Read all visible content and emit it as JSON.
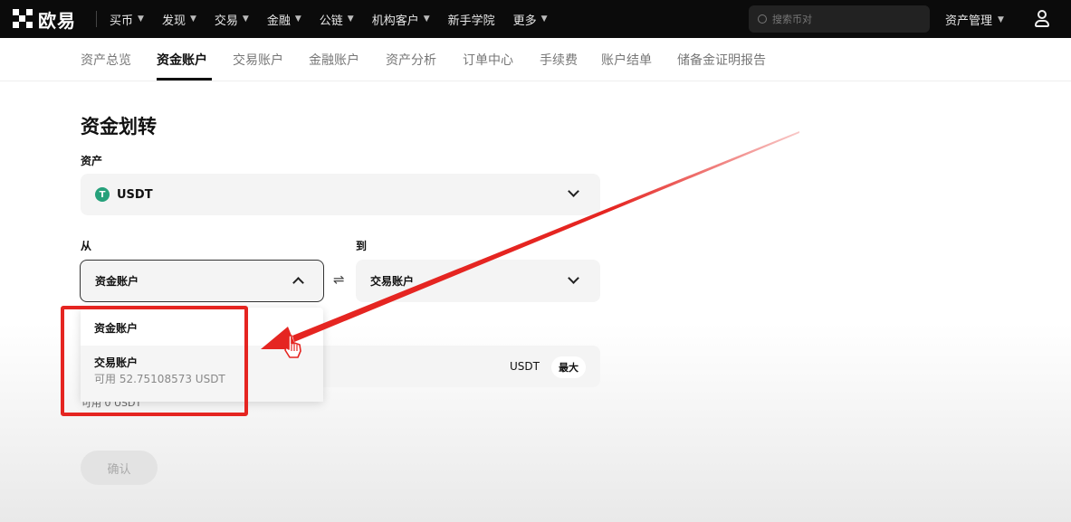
{
  "nav": {
    "logo_text": "欧易",
    "items": [
      {
        "label": "买币"
      },
      {
        "label": "发现"
      },
      {
        "label": "交易"
      },
      {
        "label": "金融"
      },
      {
        "label": "公链"
      },
      {
        "label": "机构客户"
      },
      {
        "label": "新手学院",
        "no_chevron": true
      },
      {
        "label": "更多"
      }
    ],
    "search_placeholder": "搜索币对",
    "asset_management": "资产管理"
  },
  "subnav": {
    "tabs": [
      "资产总览",
      "资金账户",
      "交易账户",
      "金融账户",
      "资产分析",
      "订单中心",
      "手续费",
      "账户结单",
      "储备金证明报告"
    ],
    "active_index": 1
  },
  "transfer": {
    "title": "资金划转",
    "asset_label": "资产",
    "asset_value": "USDT",
    "asset_coin_glyph": "T",
    "from_label": "从",
    "from_value": "资金账户",
    "to_label": "到",
    "to_value": "交易账户",
    "amount_unit": "USDT",
    "max_label": "最大",
    "available_hint": "可用 0 USDT",
    "confirm_label": "确认"
  },
  "dropdown": {
    "options": [
      {
        "name": "资金账户",
        "sub": ""
      },
      {
        "name": "交易账户",
        "sub": "可用 52.75108573 USDT"
      }
    ]
  },
  "colors": {
    "annotation_red": "#e52521",
    "usdt_green": "#26a17b",
    "nav_bg": "#0b0b0b"
  }
}
